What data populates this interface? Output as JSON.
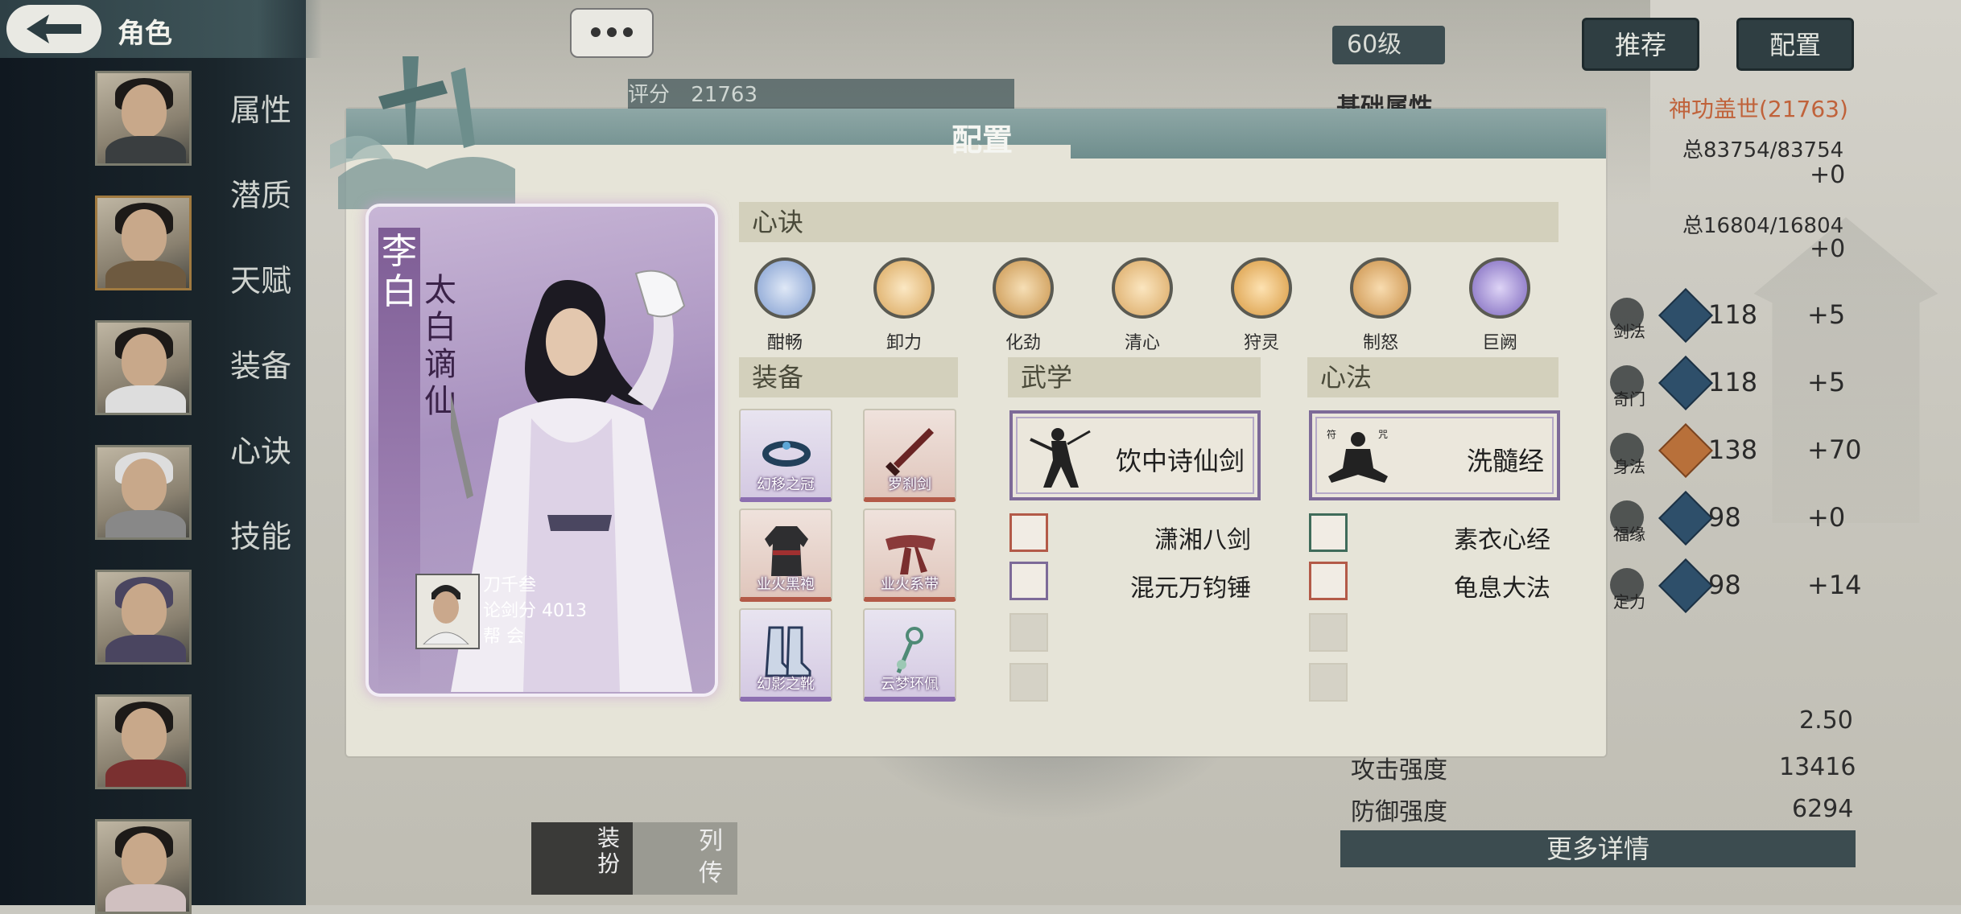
{
  "header": {
    "title": "角色"
  },
  "sidebar": {
    "menu": [
      "属性",
      "潜质",
      "天赋",
      "装备",
      "心诀",
      "技能"
    ]
  },
  "background": {
    "level": "60级",
    "score_label": "评分",
    "score_value": "21763",
    "recommend_button": "推荐",
    "config_button": "配置",
    "basic_attr_title": "基础属性",
    "title_badge": "神功盖世(21763)",
    "hp_total": "总83754/83754",
    "hp_bonus": "+0",
    "mp_total": "总16804/16804",
    "mp_bonus": "+0",
    "stats": [
      {
        "label": "剑法",
        "value": "118",
        "bonus": "+5"
      },
      {
        "label": "奇门",
        "value": "118",
        "bonus": "+5"
      },
      {
        "label": "身法",
        "value": "138",
        "bonus": "+70"
      },
      {
        "label": "福缘",
        "value": "98",
        "bonus": "+0"
      },
      {
        "label": "定力",
        "value": "98",
        "bonus": "+14"
      }
    ],
    "extra_value": "2.50",
    "attack_label": "攻击强度",
    "attack_value": "13416",
    "defense_label": "防御强度",
    "defense_value": "6294",
    "more_details": "更多详情",
    "bottom_btn1": "装扮",
    "bottom_btn2": "列传"
  },
  "dialog": {
    "title": "配置",
    "hero": {
      "name": "李白",
      "title": "太白谪仙",
      "player_name": "刀千叁",
      "sword_score_label": "论剑分",
      "sword_score": "4013",
      "guild_label": "帮 会"
    },
    "xinjue_header": "心诀",
    "xinjue": [
      {
        "label": "酣畅",
        "color": "#8ea8d8"
      },
      {
        "label": "卸力",
        "color": "#e0b36a"
      },
      {
        "label": "化劲",
        "color": "#d8a45a"
      },
      {
        "label": "清心",
        "color": "#e2b56c"
      },
      {
        "label": "狩灵",
        "color": "#e4a850"
      },
      {
        "label": "制怒",
        "color": "#d99d52"
      },
      {
        "label": "巨阙",
        "color": "#8e78c8"
      }
    ],
    "equip_header": "装备",
    "equipment": [
      {
        "label": "幻移之冠",
        "rarity": "purple"
      },
      {
        "label": "罗刹剑",
        "rarity": "red"
      },
      {
        "label": "业火黑袍",
        "rarity": "red"
      },
      {
        "label": "业火系带",
        "rarity": "red"
      },
      {
        "label": "幻影之靴",
        "rarity": "purple"
      },
      {
        "label": "云梦环佩",
        "rarity": "purple"
      }
    ],
    "wuxue_header": "武学",
    "wuxue_main": "饮中诗仙剑",
    "wuxue_sub": [
      "潇湘八剑",
      "混元万钧锤"
    ],
    "xinfa_header": "心法",
    "xinfa_main": "洗髓经",
    "xinfa_sub": [
      "素衣心经",
      "龟息大法"
    ]
  }
}
